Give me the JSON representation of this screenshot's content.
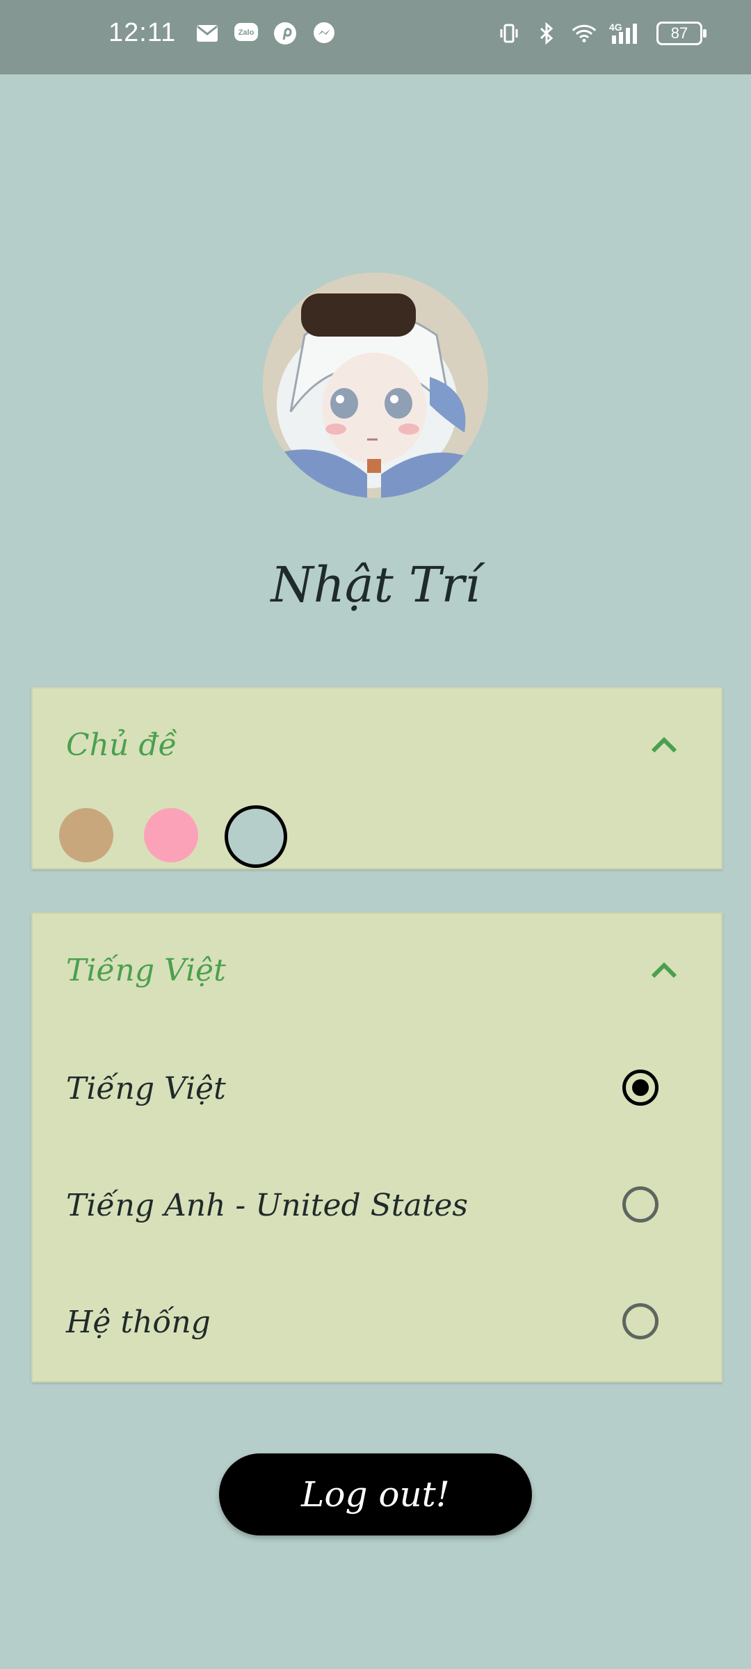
{
  "status_bar": {
    "time": "12:11",
    "battery": "87",
    "left_icons": [
      "gmail-icon",
      "zalo-icon",
      "pinterest-icon",
      "messenger-icon"
    ],
    "right_icons": [
      "vibrate-icon",
      "bluetooth-icon",
      "wifi-icon",
      "signal-4g-icon",
      "battery-icon"
    ],
    "zalo_text": "Zalo",
    "network_text": "4G"
  },
  "profile": {
    "name": "Nhật Trí"
  },
  "theme_panel": {
    "title": "Chủ đề",
    "swatches": [
      {
        "name": "tan",
        "color": "#c8a77c",
        "selected": false
      },
      {
        "name": "pink",
        "color": "#fca2b8",
        "selected": false
      },
      {
        "name": "sage",
        "color": "#b6cec9",
        "selected": true
      }
    ]
  },
  "language_panel": {
    "title": "Tiếng Việt",
    "options": [
      {
        "label": "Tiếng Việt",
        "selected": true
      },
      {
        "label": "Tiếng Anh - United States",
        "selected": false
      },
      {
        "label": "Hệ thống",
        "selected": false
      }
    ]
  },
  "logout": {
    "label": "Log out!"
  },
  "colors": {
    "background": "#b6cec9",
    "status_bar": "#849792",
    "panel": "#d8e0b9",
    "accent_green": "#4aa04f",
    "button": "#000000"
  }
}
